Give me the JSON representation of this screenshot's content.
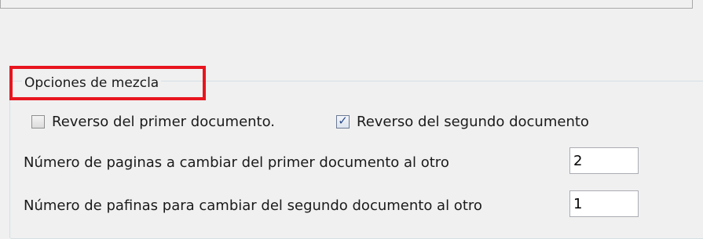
{
  "group": {
    "title": "Opciones de mezcla"
  },
  "checkboxes": [
    {
      "label": "Reverso del primer documento.",
      "checked": false
    },
    {
      "label": "Reverso del segundo documento",
      "checked": true
    }
  ],
  "fields": [
    {
      "label": "Número de paginas a cambiar del primer documento al otro",
      "value": "2"
    },
    {
      "label": "Número de pafinas para cambiar del segundo documento al otro",
      "value": "1"
    }
  ],
  "highlight_color": "#e8151e"
}
